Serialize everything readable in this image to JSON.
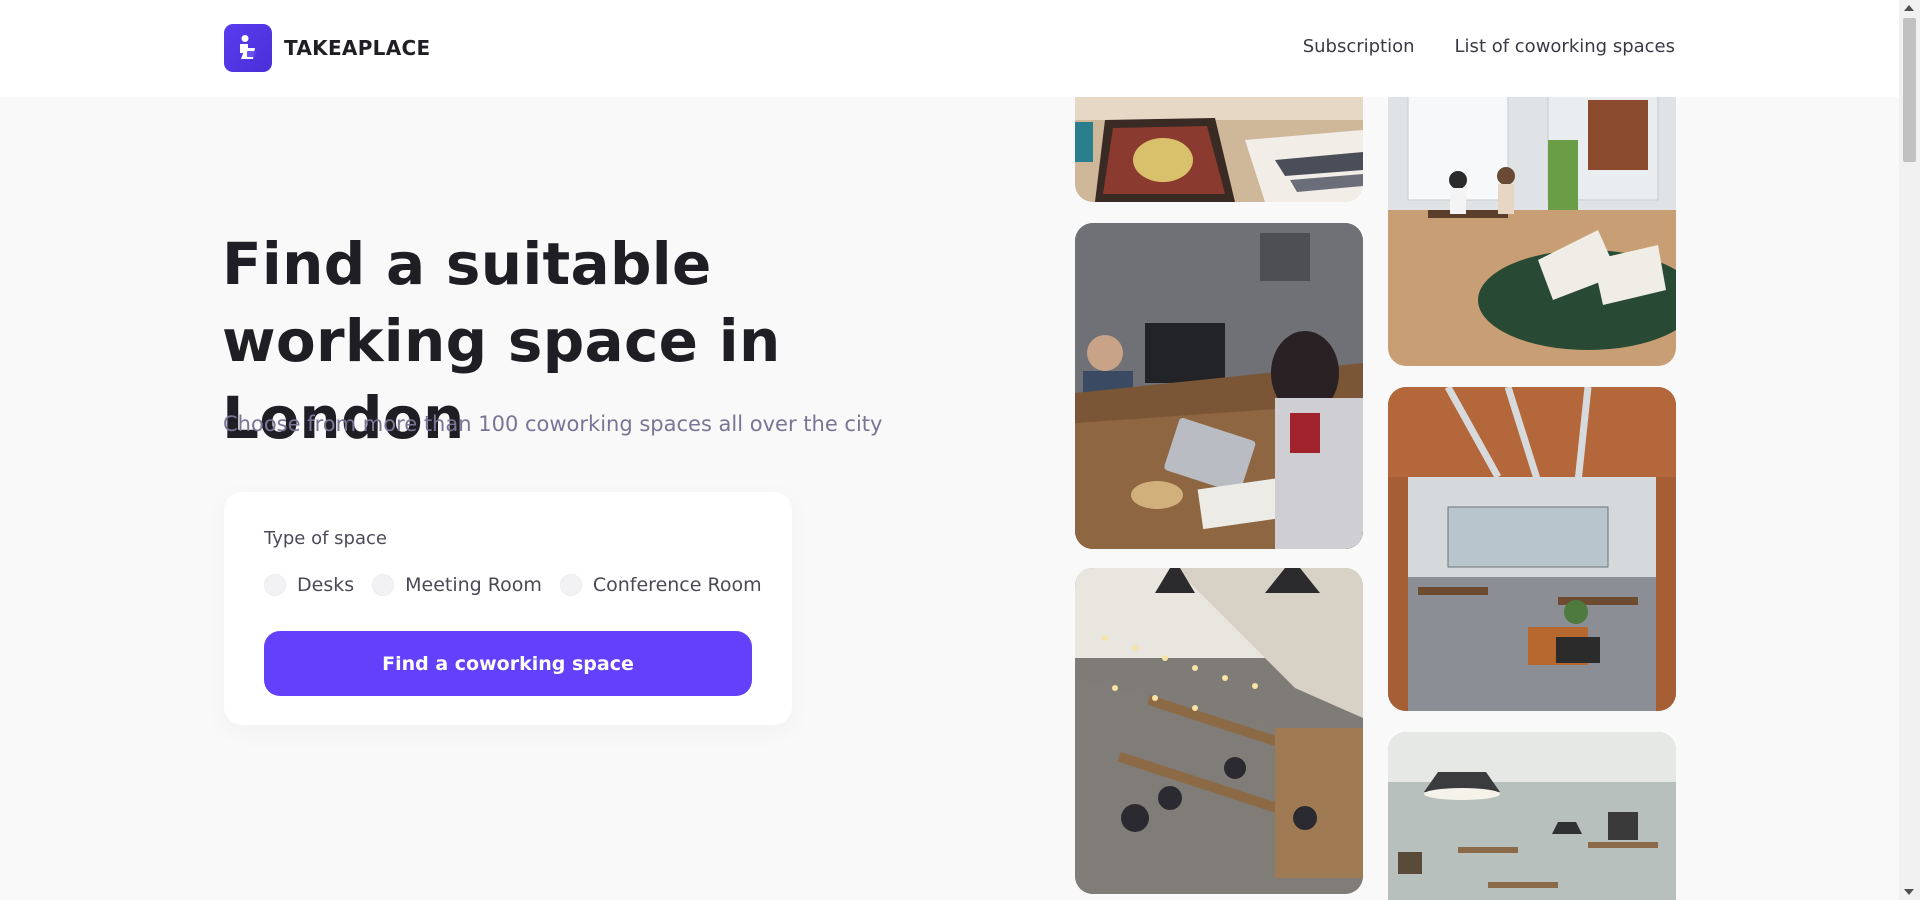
{
  "brand": {
    "name": "TAKEAPLACE",
    "accent": "#6340fa",
    "icon": "person-at-laptop-icon"
  },
  "nav": {
    "items": [
      "Subscription",
      "List of coworking spaces"
    ]
  },
  "hero": {
    "title": "Find a suitable working space in London",
    "subtitle": "Choose from more than 100 coworking spaces all over the city"
  },
  "search": {
    "label": "Type of space",
    "options": [
      "Desks",
      "Meeting Room",
      "Conference Room"
    ],
    "button": "Find a coworking space"
  },
  "gallery": {
    "images": [
      "coworking-lobby-rug",
      "basecamp-coworking-desk",
      "coworking-hall-string-lights",
      "coworking-lounge-green-rug",
      "open-office-wooden-ceiling",
      "coworking-room-pendant-lamps"
    ]
  }
}
